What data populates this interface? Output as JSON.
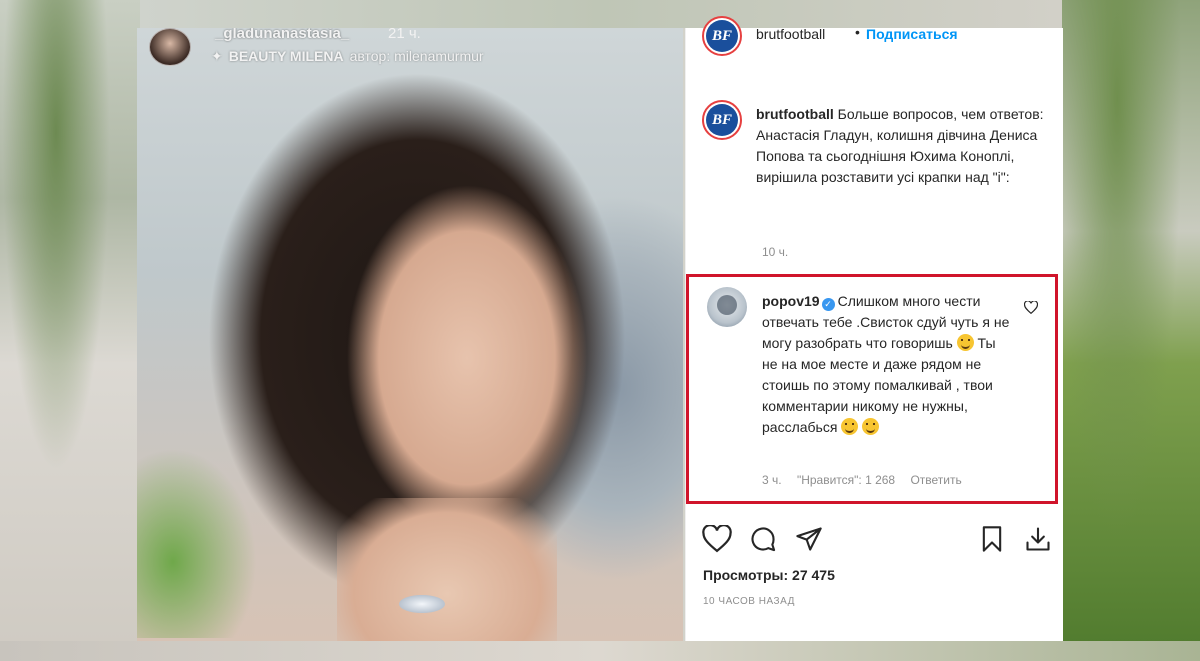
{
  "story": {
    "username": "_gladunanastasia_",
    "time": "21 ч.",
    "effect_name": "BEAUTY MILENA",
    "effect_author": "автор: milenamurmur"
  },
  "post": {
    "username": "brutfootball",
    "separator": "•",
    "follow_label": "Подписаться",
    "avatar_text": "BF",
    "caption_text": "Больше вопросов, чем ответов: Анастасія Гладун, колишня дівчина Дениса Попова та сьогоднішня Юхима Коноплі, вирішила розставити усі крапки над \"і\":",
    "caption_time": "10 ч."
  },
  "comment": {
    "username": "popov19",
    "text_1": "Слишком много чести отвечать тебе .Свисток сдуй чуть я не могу разобрать что говоришь",
    "text_2": " Ты не на мое месте и даже рядом не стоишь по этому помалкивай , твои комментарии никому не нужны, расслабься",
    "time": "3 ч.",
    "likes": "\"Нравится\": 1 268",
    "reply_label": "Ответить",
    "highlight_color": "#d0142a"
  },
  "actions": {
    "icons": [
      "heart-icon",
      "comment-icon",
      "share-icon",
      "bookmark-icon",
      "download-icon"
    ]
  },
  "views": "Просмотры: 27 475",
  "posted_ago": "10 ЧАСОВ НАЗАД"
}
